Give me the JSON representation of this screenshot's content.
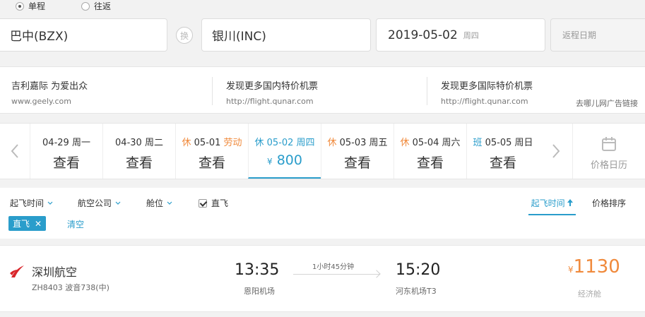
{
  "trip_type": {
    "one_way": "单程",
    "round_trip": "往返"
  },
  "search": {
    "from_city": "巴中(BZX)",
    "swap_label": "换",
    "to_city": "银川(INC)",
    "depart_date": "2019-05-02",
    "depart_weekday": "周四",
    "return_placeholder": "返程日期"
  },
  "ads": [
    {
      "title": "吉利嘉际 为爱出众",
      "url": "www.geely.com"
    },
    {
      "title": "发现更多国内特价机票",
      "url": "http://flight.qunar.com"
    },
    {
      "title": "发现更多国际特价机票",
      "url": "http://flight.qunar.com"
    }
  ],
  "ad_source": "去哪儿网广告链接",
  "date_strip": {
    "days": [
      {
        "tag": "",
        "date": "04-29",
        "weekday": "周一",
        "holiday": "",
        "price": "查看"
      },
      {
        "tag": "",
        "date": "04-30",
        "weekday": "周二",
        "holiday": "",
        "price": "查看"
      },
      {
        "tag": "休",
        "date": "05-01",
        "weekday": "",
        "holiday": "劳动",
        "price": "查看"
      },
      {
        "tag": "休",
        "date": "05-02",
        "weekday": "周四",
        "holiday": "",
        "currency": "¥",
        "price": "800"
      },
      {
        "tag": "休",
        "date": "05-03",
        "weekday": "周五",
        "holiday": "",
        "price": "查看"
      },
      {
        "tag": "休",
        "date": "05-04",
        "weekday": "周六",
        "holiday": "",
        "price": "查看"
      },
      {
        "tag": "班",
        "date": "05-05",
        "weekday": "周日",
        "holiday": "",
        "price": "查看"
      }
    ],
    "calendar_label": "价格日历"
  },
  "filters": {
    "depart_time": "起飞时间",
    "airline": "航空公司",
    "cabin": "舱位",
    "direct": "直飞",
    "sort_time": "起飞时间",
    "sort_price": "价格排序",
    "active_chip": "直飞",
    "clear": "清空"
  },
  "flight": {
    "airline": "深圳航空",
    "flight_info": "ZH8403 波音738(中)",
    "depart_time": "13:35",
    "depart_airport": "恩阳机场",
    "duration": "1小时45分钟",
    "arrive_time": "15:20",
    "arrive_airport": "河东机场T3",
    "currency": "¥",
    "price": "1130",
    "price_note": "经济舱"
  },
  "colors": {
    "accent": "#2a9dcb",
    "price": "#f08a3c",
    "holiday": "#f08a3c"
  }
}
